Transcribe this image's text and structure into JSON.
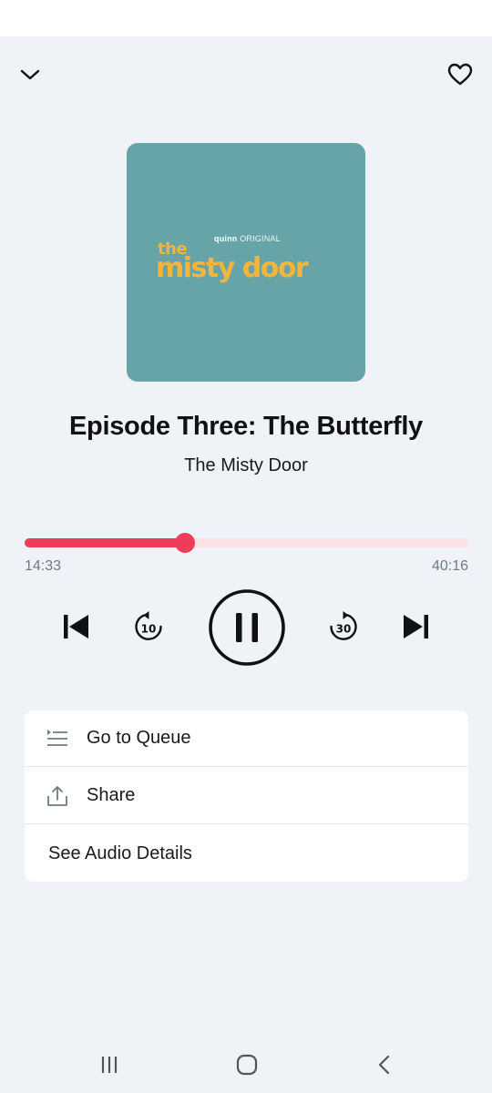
{
  "artwork": {
    "brand": "quinn",
    "brand_suffix": "ORIGINAL",
    "title_small": "the",
    "title_large": "misty door",
    "background_color": "#66a4a8",
    "title_color": "#f5b53a"
  },
  "episode": {
    "title": "Episode Three: The Butterfly",
    "show": "The Misty Door"
  },
  "player": {
    "elapsed": "14:33",
    "total": "40:16",
    "progress_fraction": 0.362,
    "rewind_seconds": "10",
    "forward_seconds": "30",
    "state": "playing"
  },
  "menu": {
    "queue_label": "Go to Queue",
    "share_label": "Share",
    "details_label": "See Audio Details"
  },
  "colors": {
    "accent": "#ef3c5a",
    "track": "#fbe0e4",
    "background": "#eff2f6",
    "muted_text": "#6c7c88"
  },
  "icons": {
    "top_left": "chevron-down-icon",
    "top_right": "heart-icon",
    "prev": "skip-previous-icon",
    "rewind": "rewind-10-icon",
    "pause": "pause-icon",
    "forward": "forward-30-icon",
    "next": "skip-next-icon",
    "queue": "queue-list-icon",
    "share": "share-icon"
  }
}
